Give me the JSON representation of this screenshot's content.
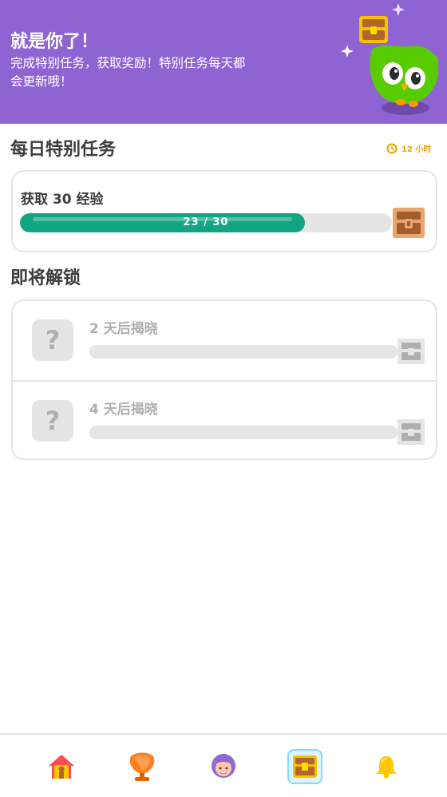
{
  "banner": {
    "title": "就是你了！",
    "text": "完成特别任务，获取奖励！特别任务每天都会更新哦！"
  },
  "daily": {
    "title": "每日特别任务",
    "timer": "12 小时",
    "quest": {
      "label": "获取 30 经验",
      "progress_text": "23 / 30",
      "progress_fraction": 0.7667
    }
  },
  "upcoming": {
    "title": "即将解锁",
    "items": [
      {
        "placeholder": "?",
        "label": "2 天后揭晓"
      },
      {
        "placeholder": "?",
        "label": "4 天后揭晓"
      }
    ]
  },
  "nav": {
    "items": [
      {
        "icon": "home-icon",
        "active": false
      },
      {
        "icon": "leaderboard-trophy-icon",
        "active": false
      },
      {
        "icon": "profile-avatar-icon",
        "active": false
      },
      {
        "icon": "quest-chest-icon",
        "active": true
      },
      {
        "icon": "notification-bell-icon",
        "active": false
      }
    ]
  },
  "colors": {
    "banner": "#8f64d2",
    "progress": "#12a584",
    "timer": "#f2a000",
    "active_nav": "#ddf4ff"
  }
}
